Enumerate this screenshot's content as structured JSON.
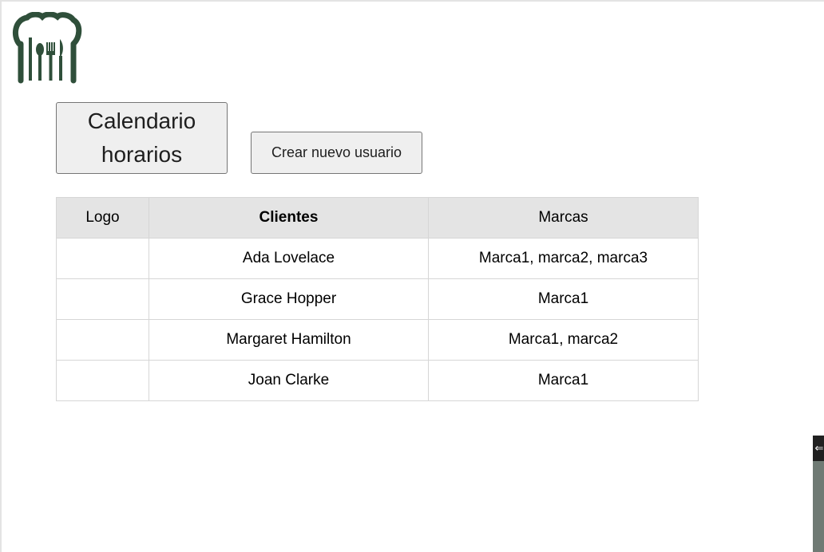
{
  "header": {
    "logo_icon": "chef-hat-cutlery-icon",
    "logo_color": "#2f4f3a"
  },
  "actions": {
    "calendar_label": "Calendario horarios",
    "create_user_label": "Crear nuevo usuario"
  },
  "table": {
    "headers": [
      "Logo",
      "Clientes",
      "Marcas"
    ],
    "rows": [
      {
        "logo": "",
        "cliente": "Ada Lovelace",
        "marcas": "Marca1, marca2, marca3"
      },
      {
        "logo": "",
        "cliente": "Grace Hopper",
        "marcas": "Marca1"
      },
      {
        "logo": "",
        "cliente": "Margaret Hamilton",
        "marcas": "Marca1, marca2"
      },
      {
        "logo": "",
        "cliente": "Joan Clarke",
        "marcas": "Marca1"
      }
    ]
  },
  "side_widget": {
    "icon": "arrow-left-icon",
    "symbol": "⇐"
  }
}
